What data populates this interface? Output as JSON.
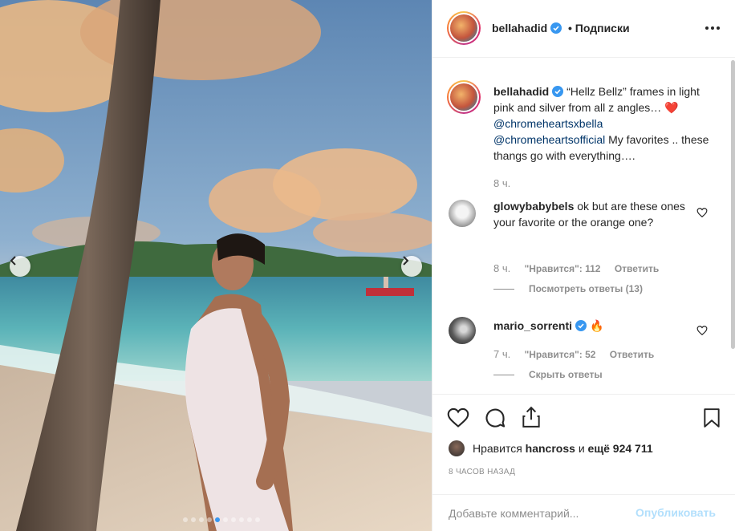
{
  "header": {
    "username": "bellahadid",
    "separator": "•",
    "follow_label": "Подписки"
  },
  "caption": {
    "username": "bellahadid",
    "text_1": "“Hellz Bellz” frames in light pink and silver from all z angles…",
    "emoji": "❤️",
    "mention_1": "@chromeheartsxbella",
    "mention_2": "@chromeheartsofficial",
    "text_2": "My favorites .. these thangs go with everything….",
    "time": "8 ч."
  },
  "comments": [
    {
      "username": "glowybabybels",
      "text": "ok but are these ones your favorite or the orange one?",
      "time": "8 ч.",
      "likes": "\"Нравится\": 112",
      "reply_label": "Ответить",
      "replies_label": "Посмотреть ответы (13)"
    },
    {
      "username": "mario_sorrenti",
      "text": "🔥",
      "time": "7 ч.",
      "likes": "\"Нравится\": 52",
      "reply_label": "Ответить",
      "replies_label": "Скрыть ответы"
    }
  ],
  "likes": {
    "prefix": "Нравится",
    "user": "hancross",
    "middle": "и",
    "count": "ещё 924 711"
  },
  "posted": "8 ЧАСОВ НАЗАД",
  "comment_box": {
    "placeholder": "Добавьте комментарий...",
    "publish_label": "Опубликовать"
  },
  "carousel": {
    "total": 10,
    "active_index": 4
  },
  "colors": {
    "accent": "#3897f0",
    "publish_disabled": "#b2dffc",
    "muted": "#8e8e8e",
    "mention": "#003569"
  }
}
